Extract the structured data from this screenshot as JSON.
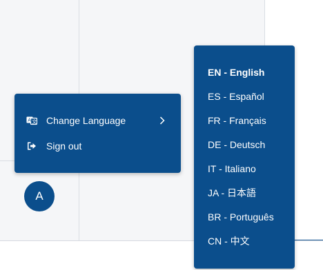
{
  "colors": {
    "menu_bg": "#0b4e8c",
    "menu_text": "#ffffff",
    "page_bg": "#f5f6f8",
    "divider": "#d9dde3"
  },
  "avatar": {
    "initial": "A"
  },
  "menu": {
    "items": [
      {
        "label": "Change Language",
        "icon": "language-icon",
        "has_submenu": true
      },
      {
        "label": "Sign out",
        "icon": "sign-out-icon",
        "has_submenu": false
      }
    ]
  },
  "language_submenu": {
    "selected": "EN - English",
    "options": [
      {
        "label": "EN - English"
      },
      {
        "label": "ES - Español"
      },
      {
        "label": "FR - Français"
      },
      {
        "label": "DE - Deutsch"
      },
      {
        "label": "IT - Italiano"
      },
      {
        "label": "JA - 日本語"
      },
      {
        "label": "BR - Português"
      },
      {
        "label": "CN - 中文"
      }
    ]
  }
}
